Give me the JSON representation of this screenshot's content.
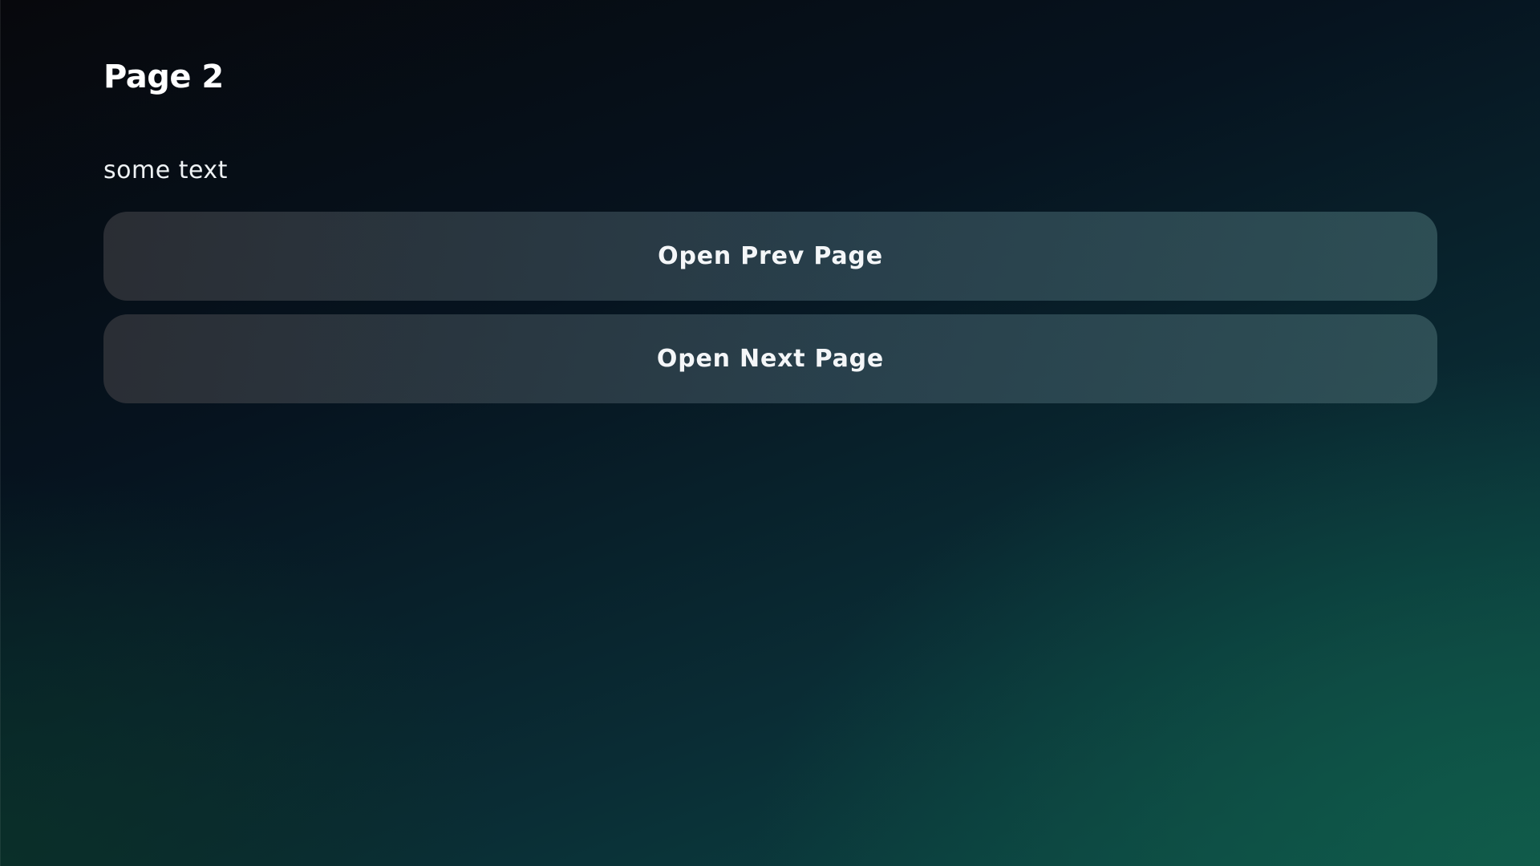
{
  "page": {
    "title": "Page 2",
    "text": "some text"
  },
  "buttons": {
    "prev_label": "Open Prev Page",
    "next_label": "Open Next Page"
  },
  "colors": {
    "background_top_left": "#07080c",
    "background_bottom_right": "#105c4a",
    "button_bg": "#2f4450",
    "text": "#ffffff"
  }
}
